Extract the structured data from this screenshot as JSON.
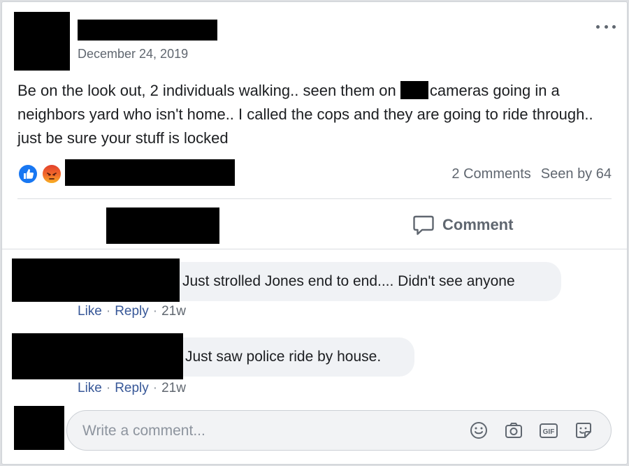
{
  "post": {
    "date": "December 24, 2019",
    "text_before": "Be on the look out, 2 individuals walking.. seen them on ",
    "text_after": "cameras going in a neighbors yard who isn't home.. I called the cops and they are going to ride through.. just be sure your stuff is locked",
    "comments_count": "2 Comments",
    "seen_by": "Seen by 64",
    "comment_label": "Comment",
    "reaction_icons": [
      "like-reaction-icon",
      "angry-reaction-icon"
    ]
  },
  "comments": [
    {
      "text": "Just strolled Jones end to end.... Didn't see anyone",
      "like": "Like",
      "reply": "Reply",
      "time": "21w"
    },
    {
      "text": "Just saw police ride by house.",
      "like": "Like",
      "reply": "Reply",
      "time": "21w"
    }
  ],
  "composer": {
    "placeholder": "Write a comment...",
    "tools": [
      "emoji-icon",
      "camera-icon",
      "gif-icon",
      "sticker-icon"
    ]
  },
  "colors": {
    "like_blue": "#1877f2",
    "link": "#385898",
    "muted": "#606770",
    "bubble": "#f0f2f5"
  }
}
